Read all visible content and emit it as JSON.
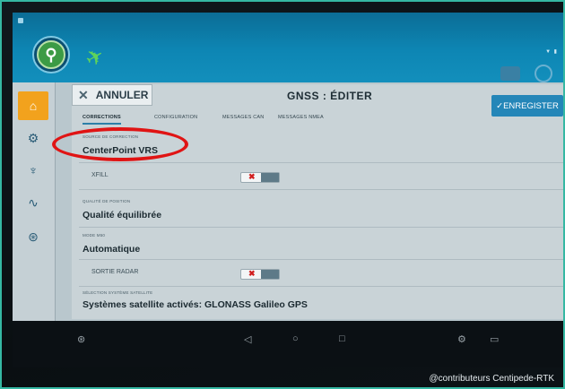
{
  "header": {
    "cancel_label": "ANNULER",
    "title": "GNSS : ÉDITER",
    "save_label": "✓ENREGISTER"
  },
  "tabs": [
    {
      "label": "CORRECTIONS",
      "active": true
    },
    {
      "label": "CONFIGURATION",
      "active": false
    },
    {
      "label": "MESSAGES CAN",
      "active": false
    },
    {
      "label": "MESSAGES NMEA",
      "active": false
    }
  ],
  "fields": {
    "correction_source": {
      "label": "SOURCE DE CORRECTION",
      "value": "CenterPoint VRS"
    },
    "xfill": {
      "label": "XFILL",
      "toggle_on": false
    },
    "position_quality": {
      "label": "QUALITÉ DE POSITION",
      "value": "Qualité équilibrée"
    },
    "mode": {
      "label": "MODE M50",
      "value": "Automatique"
    },
    "radar_output": {
      "label": "SORTIE RADAR",
      "toggle_on": false
    },
    "satellite_selection": {
      "label": "SÉLECTION SYSTÈME SATELLITE",
      "value": "Systèmes satellite activés: GLONASS Galileo GPS"
    }
  },
  "watermark": "@contributeurs Centipede-RTK",
  "colors": {
    "accent": "#2486b8",
    "home_active": "#f2a21d",
    "highlight": "#e01414",
    "frame": "#35b8a3"
  },
  "icons": [
    "home-icon",
    "steering-icon",
    "antenna-icon",
    "wave-icon",
    "dollar-icon",
    "satellite-icon",
    "tractor-icon",
    "wheel-icon"
  ]
}
